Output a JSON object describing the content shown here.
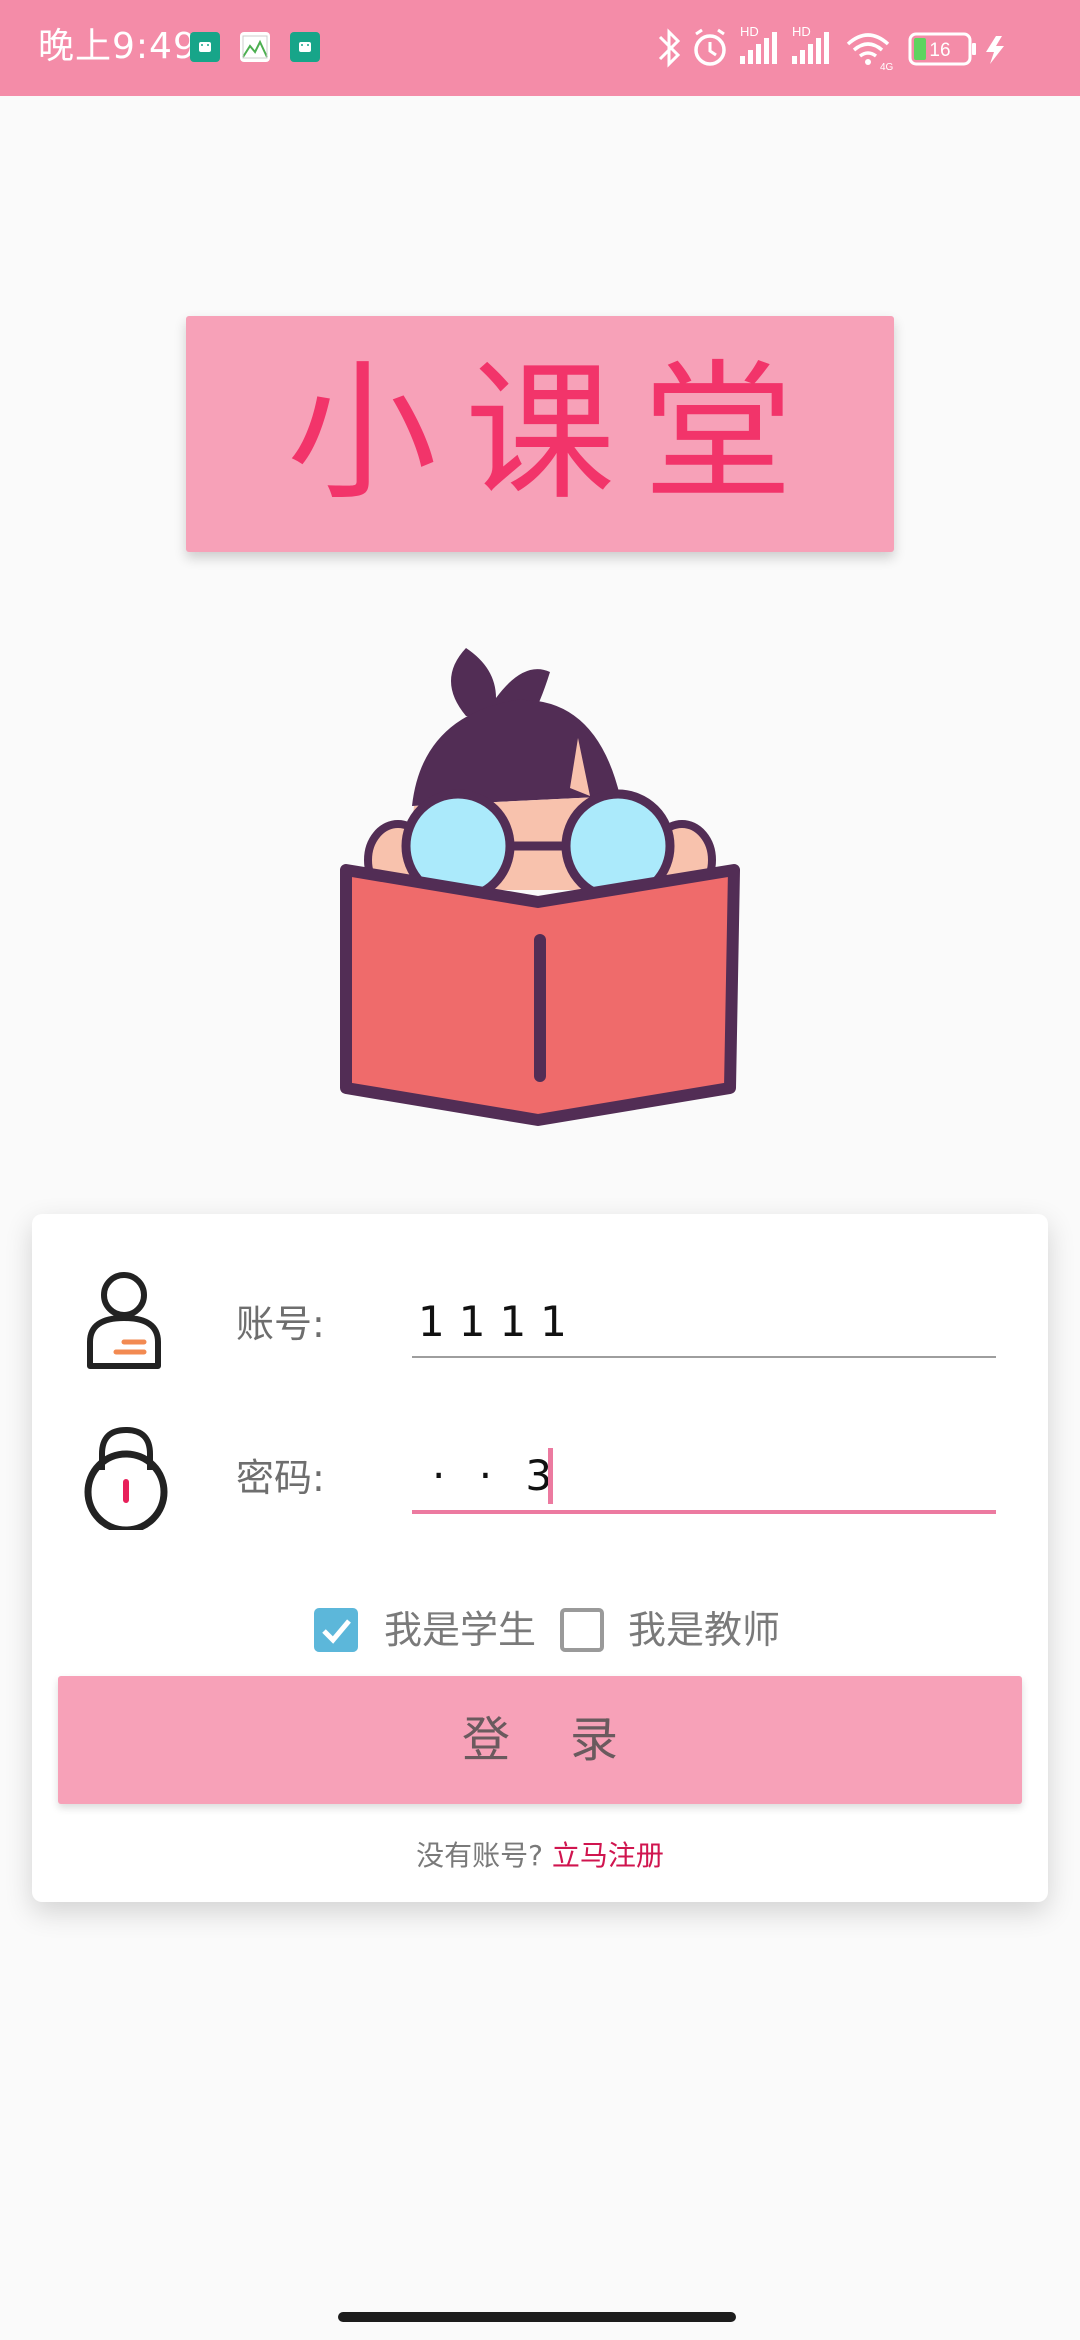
{
  "status_bar": {
    "time": "晚上9:49",
    "battery": "16",
    "hd_label": "HD",
    "network_label": "4G",
    "icons": [
      "android-notification-icon",
      "image-notification-icon",
      "android-notification-icon",
      "bluetooth-icon",
      "alarm-icon",
      "signal-icon",
      "signal-icon",
      "wifi-icon",
      "battery-icon",
      "charging-icon"
    ]
  },
  "app": {
    "title": "小课堂"
  },
  "login": {
    "account_label": "账号:",
    "account_value": "1111",
    "password_label": "密码:",
    "password_value": "· · 3",
    "student_checkbox": {
      "label": "我是学生",
      "checked": true
    },
    "teacher_checkbox": {
      "label": "我是教师",
      "checked": false
    },
    "login_button": "登录",
    "no_account_text": "没有账号?",
    "register_link": "立马注册"
  },
  "colors": {
    "accent": "#f48ca8",
    "card_pink": "#f7a1b8",
    "title_text": "#f2346a",
    "link": "#d0154f",
    "checkbox": "#5cb7da"
  }
}
